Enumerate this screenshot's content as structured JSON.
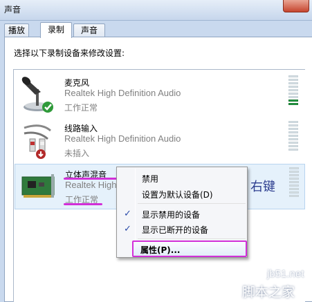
{
  "window": {
    "title": "声音"
  },
  "tabs": [
    {
      "label": "播放",
      "active": false
    },
    {
      "label": "录制",
      "active": true
    },
    {
      "label": "声音",
      "active": false
    }
  ],
  "instruction": "选择以下录制设备来修改设置:",
  "devices": [
    {
      "name": "麦克风",
      "description": "Realtek High Definition Audio",
      "status": "工作正常",
      "icon": "microphone-icon",
      "badge": "green-check-icon",
      "level_segments_on": 2
    },
    {
      "name": "线路输入",
      "description": "Realtek High Definition Audio",
      "status": "未插入",
      "icon": "line-in-cable-icon",
      "badge": "red-down-arrow-icon",
      "level_segments_on": 0
    },
    {
      "name": "立体声混音",
      "description": "Realtek High",
      "status": "工作正常",
      "icon": "sound-card-icon",
      "badge": "",
      "level_segments_on": 0
    }
  ],
  "context_menu": {
    "items": [
      {
        "label": "禁用",
        "checked": false
      },
      {
        "label": "设置为默认设备(D)",
        "checked": false
      },
      {
        "label": "显示禁用的设备",
        "checked": true
      },
      {
        "label": "显示已断开的设备",
        "checked": true
      },
      {
        "label": "属性(P)...",
        "checked": false,
        "highlighted": true
      }
    ]
  },
  "annotation": "右键",
  "watermark": {
    "site": "jb51.net",
    "name": "脚本之家"
  },
  "colors": {
    "highlight": "#d22fd8",
    "level_on": "#28a34a",
    "selection": "#e5f1fb"
  }
}
